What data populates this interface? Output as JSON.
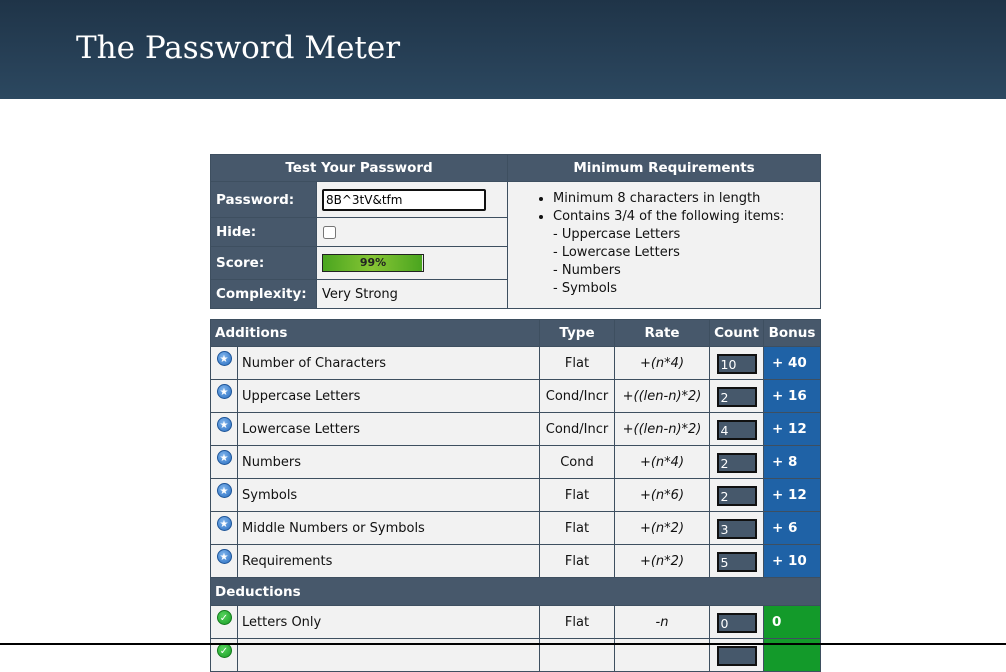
{
  "site": {
    "title": "The Password Meter"
  },
  "test": {
    "heading": "Test Your Password",
    "password_label": "Password:",
    "password_value": "8B^3tV&tfm",
    "hide_label": "Hide:",
    "hide_checked": false,
    "score_label": "Score:",
    "score_text": "99%",
    "score_value": 0.99,
    "complexity_label": "Complexity:",
    "complexity_value": "Very Strong"
  },
  "requirements": {
    "heading": "Minimum Requirements",
    "items": [
      "Minimum 8 characters in length",
      "Contains 3/4 of the following items:",
      "- Uppercase Letters",
      "- Lowercase Letters",
      "- Numbers",
      "- Symbols"
    ]
  },
  "additions": {
    "headers": {
      "name": "Additions",
      "type": "Type",
      "rate": "Rate",
      "count": "Count",
      "bonus": "Bonus"
    },
    "rows": [
      {
        "name": "Number of Characters",
        "type": "Flat",
        "rate": "+(n*4)",
        "count": "10",
        "bonus": "+ 40",
        "icon": "blue-star-icon"
      },
      {
        "name": "Uppercase Letters",
        "type": "Cond/Incr",
        "rate": "+((len-n)*2)",
        "count": "2",
        "bonus": "+ 16",
        "icon": "blue-star-icon"
      },
      {
        "name": "Lowercase Letters",
        "type": "Cond/Incr",
        "rate": "+((len-n)*2)",
        "count": "4",
        "bonus": "+ 12",
        "icon": "blue-star-icon"
      },
      {
        "name": "Numbers",
        "type": "Cond",
        "rate": "+(n*4)",
        "count": "2",
        "bonus": "+ 8",
        "icon": "blue-star-icon"
      },
      {
        "name": "Symbols",
        "type": "Flat",
        "rate": "+(n*6)",
        "count": "2",
        "bonus": "+ 12",
        "icon": "blue-star-icon"
      },
      {
        "name": "Middle Numbers or Symbols",
        "type": "Flat",
        "rate": "+(n*2)",
        "count": "3",
        "bonus": "+ 6",
        "icon": "blue-star-icon"
      },
      {
        "name": "Requirements",
        "type": "Flat",
        "rate": "+(n*2)",
        "count": "5",
        "bonus": "+ 10",
        "icon": "blue-star-icon"
      }
    ]
  },
  "deductions": {
    "heading": "Deductions",
    "rows": [
      {
        "name": "Letters Only",
        "type": "Flat",
        "rate": "-n",
        "count": "0",
        "bonus": "0",
        "icon": "green-check-icon"
      }
    ]
  },
  "colors": {
    "header_bg": "#2c4860",
    "table_header": "#47586b",
    "bonus_blue": "#1f62a6",
    "bonus_green": "#139a2a",
    "score_green": "#4aa51f"
  }
}
